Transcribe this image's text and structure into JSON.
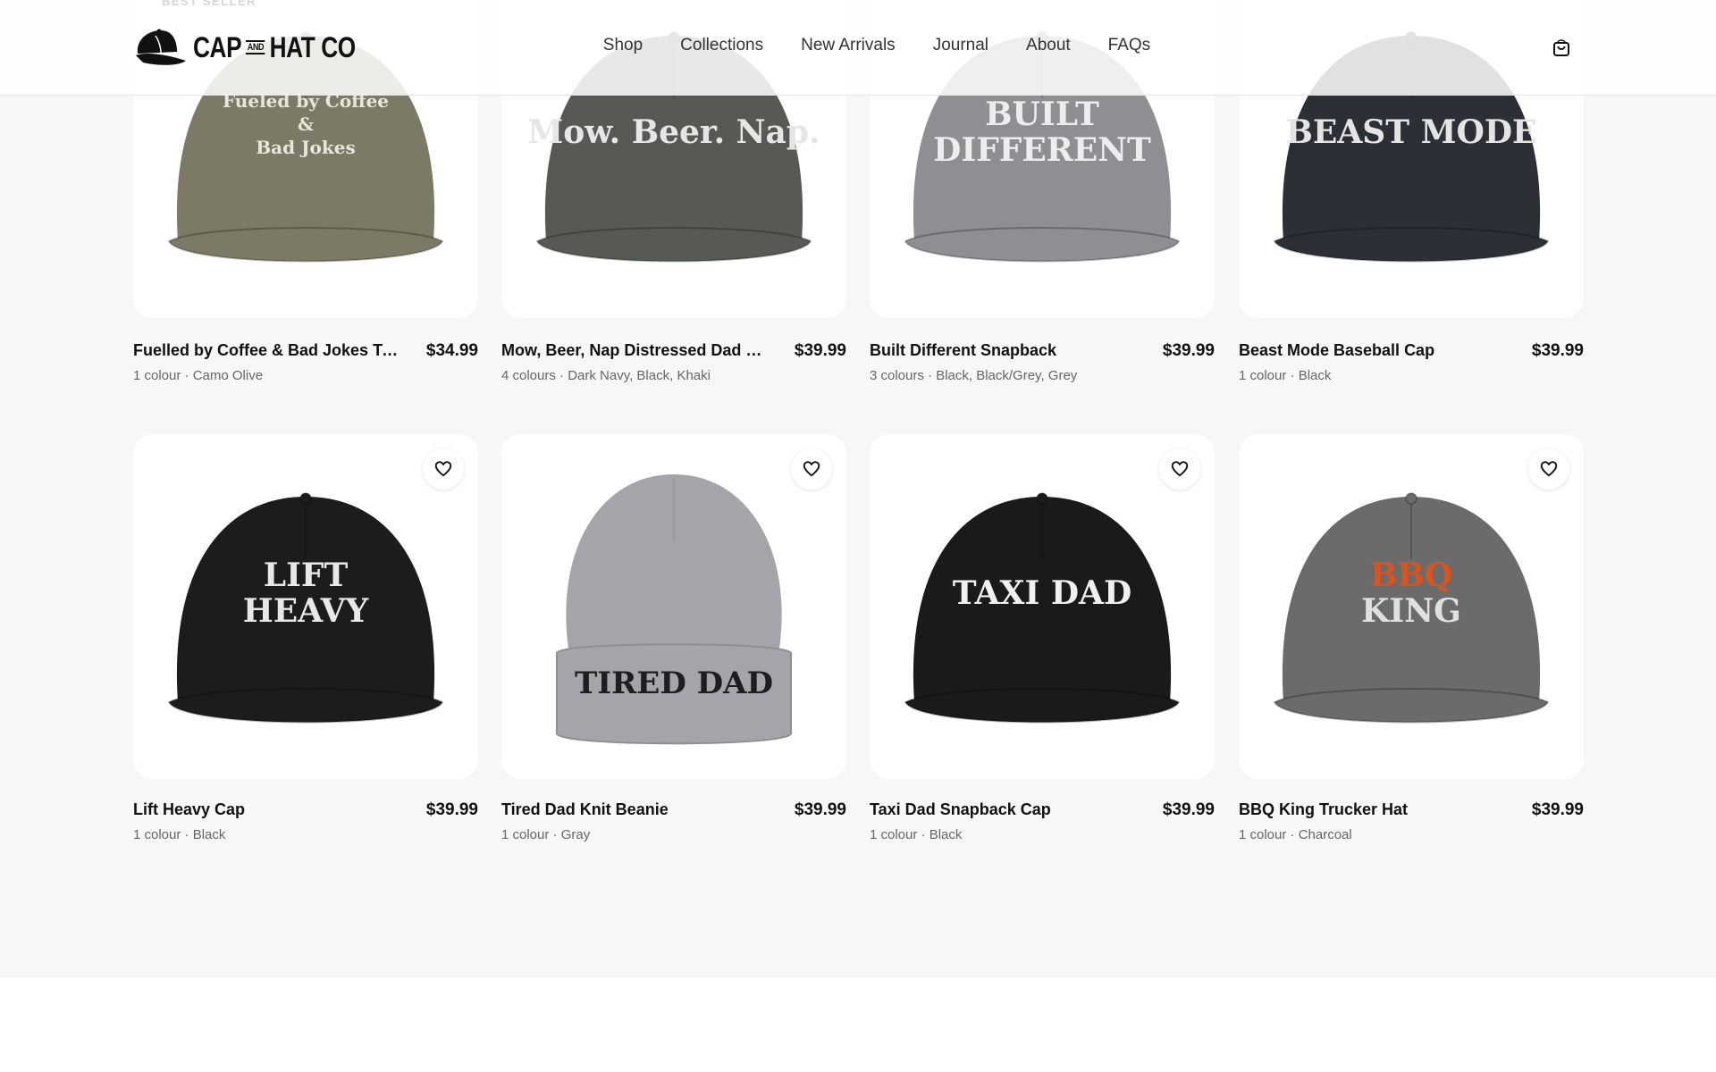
{
  "brand": {
    "name_left": "CAP",
    "name_and": "AND",
    "name_right": "HAT CO"
  },
  "nav": [
    "Shop",
    "Collections",
    "New Arrivals",
    "Journal",
    "About",
    "FAQs"
  ],
  "badge": "BEST SELLER",
  "products": [
    {
      "title": "Fuelled by Coffee & Bad Jokes Trucker Hat",
      "price": "$34.99",
      "meta": "1 colour · Camo Olive",
      "print": [
        "Fueled by Coffee",
        "&",
        "Bad Jokes"
      ],
      "hat_color": "#7c7a66",
      "text_color": "#e9e6dc"
    },
    {
      "title": "Mow, Beer, Nap Distressed Dad Hat",
      "price": "$39.99",
      "meta": "4 colours · Dark Navy, Black, Khaki",
      "print": [
        "Mow. Beer. Nap."
      ],
      "hat_color": "#575a54",
      "text_color": "#e6e6e6"
    },
    {
      "title": "Built Different Snapback",
      "price": "$39.99",
      "meta": "3 colours · Black, Black/Grey, Grey",
      "print": [
        "BUILT",
        "DIFFERENT"
      ],
      "hat_color": "#8f8f93",
      "text_color": "#ededed"
    },
    {
      "title": "Beast Mode Baseball Cap",
      "price": "$39.99",
      "meta": "1 colour · Black",
      "print": [
        "BEAST MODE"
      ],
      "hat_color": "#2d2f37",
      "text_color": "#e4e4e4"
    },
    {
      "title": "Lift Heavy Cap",
      "price": "$39.99",
      "meta": "1 colour · Black",
      "print": [
        "LIFT",
        "HEAVY"
      ],
      "hat_color": "#1c1c1c",
      "text_color": "#e8e8e8"
    },
    {
      "title": "Tired Dad Knit Beanie",
      "price": "$39.99",
      "meta": "1 colour · Gray",
      "print": [
        "TIRED DAD"
      ],
      "hat_color": "#a4a4aa",
      "text_color": "#1e1e1e"
    },
    {
      "title": "Taxi Dad Snapback Cap",
      "price": "$39.99",
      "meta": "1 colour · Black",
      "print": [
        "TAXI DAD"
      ],
      "hat_color": "#1a1a1a",
      "text_color": "#f0f0f0"
    },
    {
      "title": "BBQ King Trucker Hat",
      "price": "$39.99",
      "meta": "1 colour · Charcoal",
      "print": [
        "BBQ",
        "KING"
      ],
      "hat_color": "#6c6b6b",
      "text_color": "#e0e0e0"
    }
  ],
  "colors": {
    "accent": "#111111",
    "bbq_orange": "#d9541e"
  },
  "icons": {
    "cart": "shopping-bag-icon",
    "wishlist": "heart-icon"
  }
}
